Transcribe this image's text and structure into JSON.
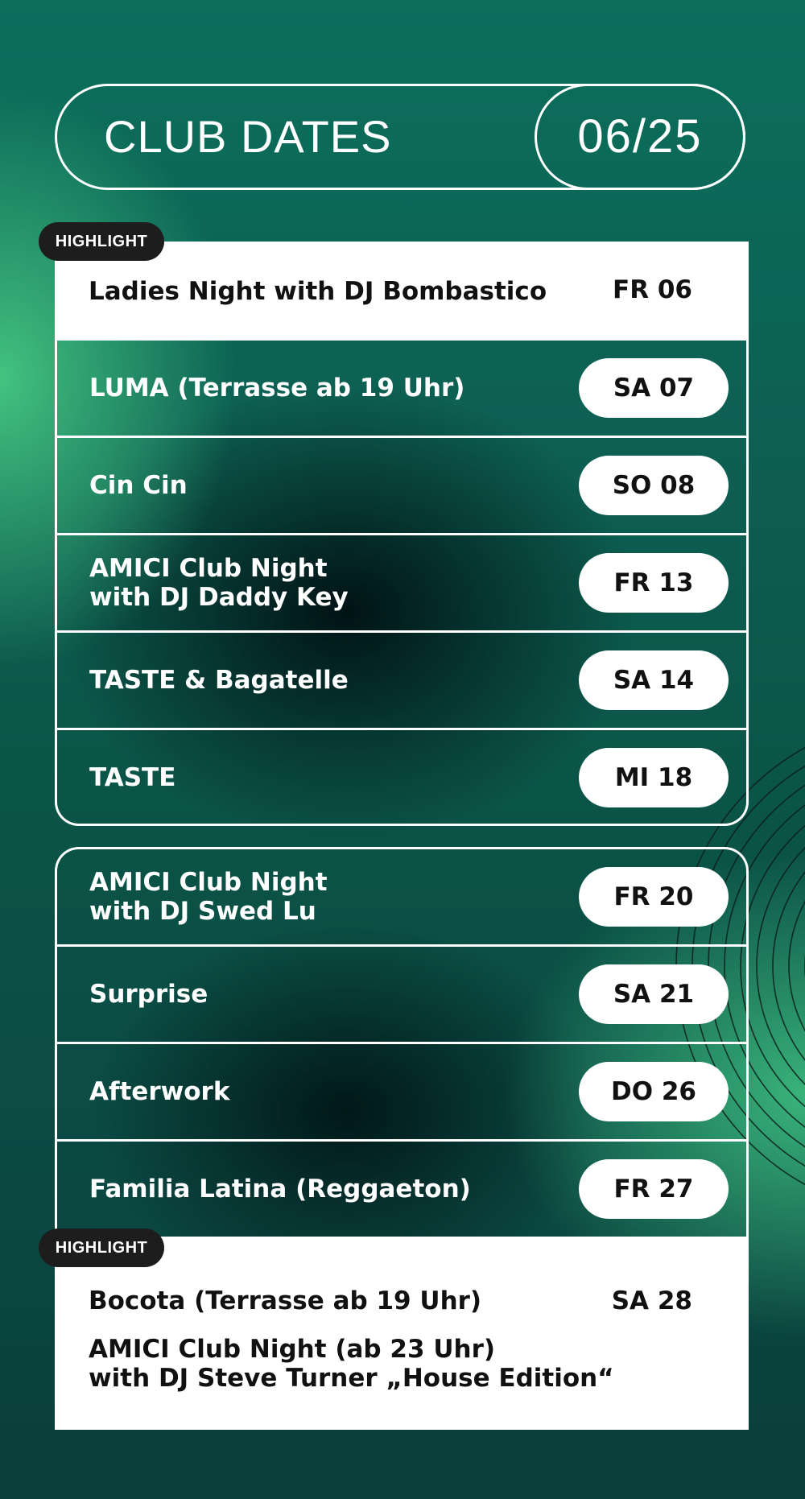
{
  "header": {
    "title": "CLUB DATES",
    "month": "06/25"
  },
  "highlight_label": "HIGHLIGHT",
  "highlight_top": {
    "title": "Ladies Night with DJ Bombastico",
    "date": "FR 06"
  },
  "events_group1": [
    {
      "title": [
        "LUMA (Terrasse ab 19 Uhr)"
      ],
      "date": "SA 07"
    },
    {
      "title": [
        "Cin Cin"
      ],
      "date": "SO 08"
    },
    {
      "title": [
        "AMICI Club Night",
        "with DJ Daddy Key"
      ],
      "date": "FR 13"
    },
    {
      "title": [
        "TASTE & Bagatelle"
      ],
      "date": "SA 14"
    },
    {
      "title": [
        "TASTE"
      ],
      "date": "MI 18"
    }
  ],
  "events_group2": [
    {
      "title": [
        "AMICI Club Night",
        "with DJ Swed Lu"
      ],
      "date": "FR 20"
    },
    {
      "title": [
        "Surprise"
      ],
      "date": "SA 21"
    },
    {
      "title": [
        "Afterwork"
      ],
      "date": "DO 26"
    },
    {
      "title": [
        "Familia Latina (Reggaeton)"
      ],
      "date": "FR 27"
    }
  ],
  "highlight_bottom": {
    "title": "Bocota (Terrasse ab 19 Uhr)",
    "date": "SA 28",
    "subtitle_line1": "AMICI Club Night (ab 23 Uhr)",
    "subtitle_line2": "with DJ Steve Turner „House Edition“"
  },
  "colors": {
    "background": "#0b5a4c",
    "accent_green": "#46c882",
    "white": "#ffffff",
    "badge": "#1d1d1d"
  }
}
